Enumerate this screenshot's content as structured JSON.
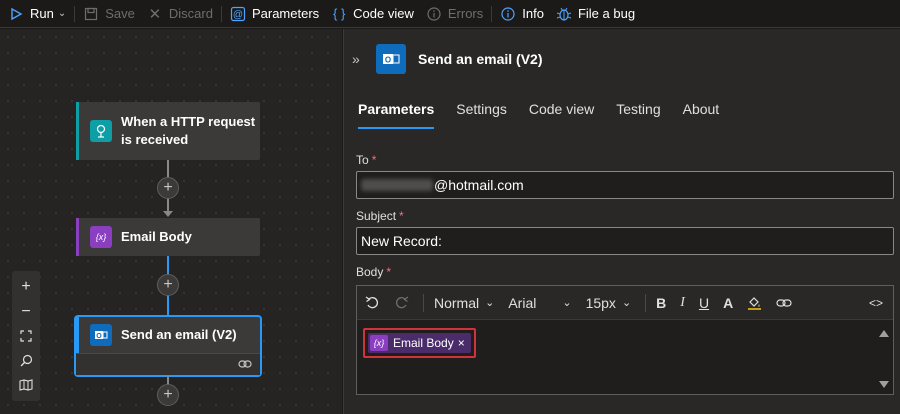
{
  "toolbar": {
    "run": "Run",
    "save": "Save",
    "discard": "Discard",
    "parameters": "Parameters",
    "code_view": "Code view",
    "errors": "Errors",
    "info": "Info",
    "file_bug": "File a bug"
  },
  "canvas": {
    "trigger": {
      "title": "When a HTTP request is received",
      "icon": "http-request-icon",
      "accent": "#0e9fa6"
    },
    "variable": {
      "title": "Email Body",
      "icon": "variable-icon",
      "accent": "#8a3fc0"
    },
    "action": {
      "title": "Send an email (V2)",
      "icon": "outlook-icon",
      "accent": "#2899f5"
    },
    "zoom": {
      "in": "+",
      "out": "−"
    }
  },
  "panel": {
    "title": "Send an email (V2)",
    "tabs": [
      "Parameters",
      "Settings",
      "Code view",
      "Testing",
      "About"
    ],
    "active_tab": "Parameters",
    "to": {
      "label": "To",
      "value": "@hotmail.com"
    },
    "subject": {
      "label": "Subject",
      "value": "New Record:"
    },
    "body": {
      "label": "Body",
      "toolbar": {
        "style": "Normal",
        "font": "Arial",
        "size": "15px"
      },
      "token": {
        "label": "Email Body",
        "icon": "{x}"
      }
    }
  },
  "colors": {
    "accent": "#2899f5",
    "variable": "#8a3fc0",
    "required": "#f1707b",
    "highlight": "#d13438"
  }
}
